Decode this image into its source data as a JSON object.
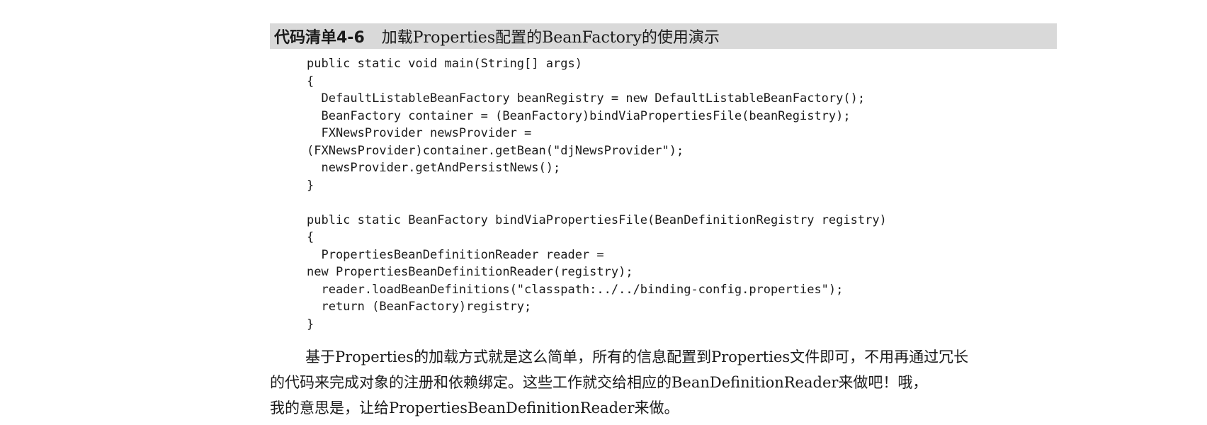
{
  "caption": {
    "label": "代码清单4-6",
    "title": "加载Properties配置的BeanFactory的使用演示"
  },
  "code_lines": [
    "public static void main(String[] args)",
    "{",
    "  DefaultListableBeanFactory beanRegistry = new DefaultListableBeanFactory();",
    "  BeanFactory container = (BeanFactory)bindViaPropertiesFile(beanRegistry);",
    "  FXNewsProvider newsProvider =",
    "(FXNewsProvider)container.getBean(\"djNewsProvider\");",
    "  newsProvider.getAndPersistNews();",
    "}",
    "",
    "public static BeanFactory bindViaPropertiesFile(BeanDefinitionRegistry registry)",
    "{",
    "  PropertiesBeanDefinitionReader reader =",
    "new PropertiesBeanDefinitionReader(registry);",
    "  reader.loadBeanDefinitions(\"classpath:../../binding-config.properties\");",
    "  return (BeanFactory)registry;",
    "}"
  ],
  "paragraph": {
    "lines": [
      "基于Properties的加载方式就是这么简单，所有的信息配置到Properties文件即可，不用再通过冗长",
      "的代码来完成对象的注册和依赖绑定。这些工作就交给相应的BeanDefinitionReader来做吧！哦，",
      "我的意思是，让给PropertiesBeanDefinitionReader来做。"
    ]
  }
}
